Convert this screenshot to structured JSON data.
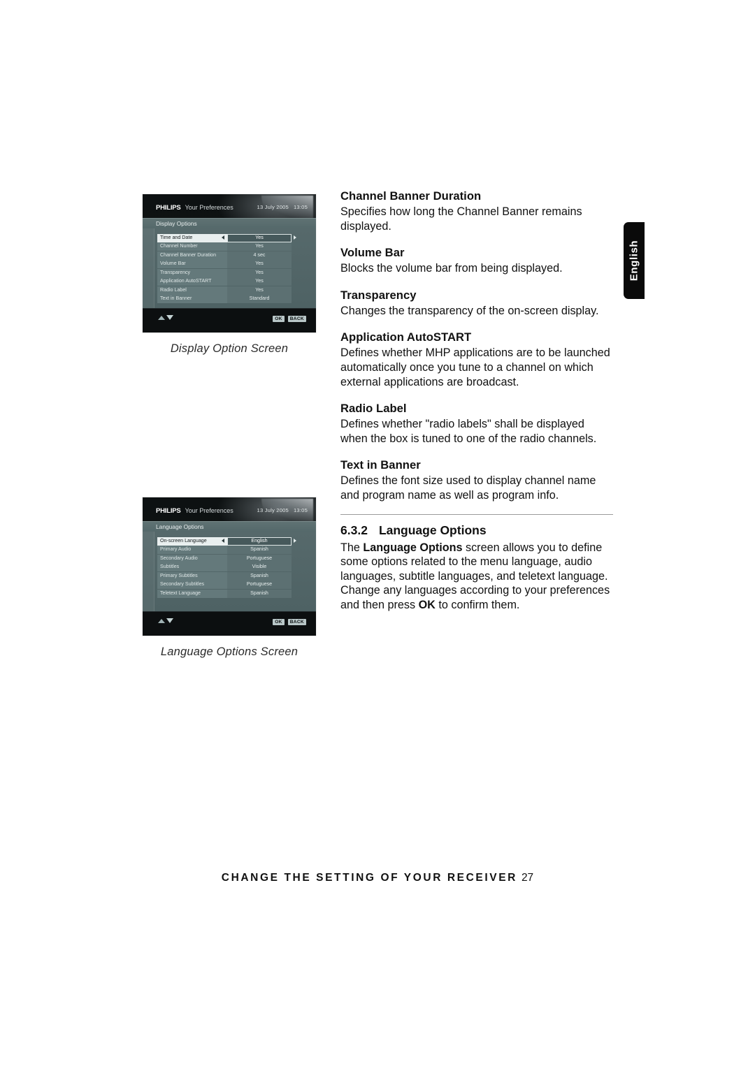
{
  "language_tab": {
    "label": "English"
  },
  "figures": [
    {
      "caption": "Display Option Screen",
      "brand": "PHILIPS",
      "brand_sub": "Your Preferences",
      "date": "13 July 2005",
      "time": "13:05",
      "menu_title": "Display Options",
      "rows": [
        {
          "label": "Time and Date",
          "value": "Yes",
          "selected": true
        },
        {
          "label": "Channel Number",
          "value": "Yes",
          "selected": false
        },
        {
          "label": "Channel Banner Duration",
          "value": "4 sec",
          "selected": false
        },
        {
          "label": "Volume Bar",
          "value": "Yes",
          "selected": false
        },
        {
          "label": "Transparency",
          "value": "Yes",
          "selected": false
        },
        {
          "label": "Application AutoSTART",
          "value": "Yes",
          "selected": false
        },
        {
          "label": "Radio Label",
          "value": "Yes",
          "selected": false
        },
        {
          "label": "Text in Banner",
          "value": "Standard",
          "selected": false
        }
      ],
      "softkeys": [
        "OK",
        "BACK"
      ]
    },
    {
      "caption": "Language Options Screen",
      "brand": "PHILIPS",
      "brand_sub": "Your Preferences",
      "date": "13 July 2005",
      "time": "13:05",
      "menu_title": "Language Options",
      "rows": [
        {
          "label": "On-screen Language",
          "value": "English",
          "selected": true
        },
        {
          "label": "Primary Audio",
          "value": "Spanish",
          "selected": false
        },
        {
          "label": "Secondary Audio",
          "value": "Portuguese",
          "selected": false
        },
        {
          "label": "Subtitles",
          "value": "Visible",
          "selected": false
        },
        {
          "label": "Primary Subtitles",
          "value": "Spanish",
          "selected": false
        },
        {
          "label": "Secondary Subtitles",
          "value": "Portuguese",
          "selected": false
        },
        {
          "label": "Teletext Language",
          "value": "Spanish",
          "selected": false
        }
      ],
      "softkeys": [
        "OK",
        "BACK"
      ]
    }
  ],
  "definitions": [
    {
      "term": "Channel Banner Duration",
      "text": "Specifies how long the Channel Banner remains displayed."
    },
    {
      "term": "Volume Bar",
      "text": "Blocks the volume bar from being displayed."
    },
    {
      "term": "Transparency",
      "text": "Changes the transparency of the on-screen display."
    },
    {
      "term": "Application AutoSTART",
      "text": "Defines whether MHP applications are to be launched automatically once you tune to a channel on which external applications are broadcast."
    },
    {
      "term": "Radio Label",
      "text": "Defines whether \"radio labels\" shall be displayed when the box is tuned to one of the radio channels."
    },
    {
      "term": "Text in Banner",
      "text": "Defines the font size used to display channel name and program name as well as program info."
    }
  ],
  "section": {
    "number": "6.3.2",
    "title": "Language Options",
    "body_part1": "The ",
    "body_bold1": "Language Options",
    "body_part2": " screen allows you to define some options related to the menu language, audio languages, subtitle languages, and teletext language. Change any languages according to your preferences and then press ",
    "body_bold2": "OK",
    "body_part3": " to confirm them."
  },
  "footer": {
    "title": "CHANGE THE SETTING OF YOUR RECEIVER",
    "page": "27"
  }
}
